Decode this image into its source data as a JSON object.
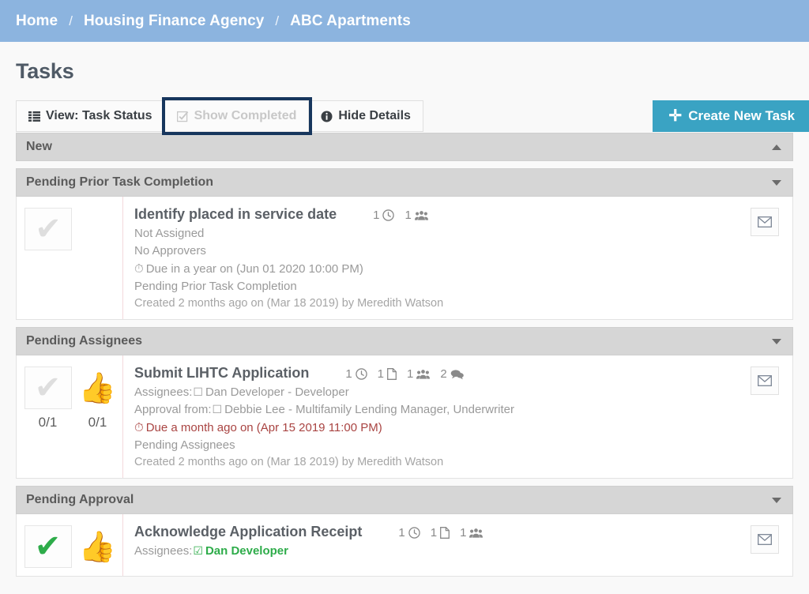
{
  "breadcrumb": {
    "separator": "/",
    "items": [
      {
        "label": "Home"
      },
      {
        "label": "Housing Finance Agency"
      },
      {
        "label": "ABC Apartments"
      }
    ]
  },
  "page": {
    "title": "Tasks"
  },
  "toolbar": {
    "view_label": "View: Task Status",
    "view_icon": "list-icon",
    "show_completed_label": "Show Completed",
    "show_completed_icon": "checkbox-checked-icon",
    "show_completed_disabled": true,
    "show_completed_focused": true,
    "hide_details_label": "Hide Details",
    "hide_details_icon": "info-icon",
    "create_label": "Create New Task",
    "create_icon": "plus-icon",
    "create_color": "#3aa3c3",
    "focus_ring_color": "#17365d"
  },
  "colors": {
    "breadcrumb_bg": "#8cb4df",
    "page_bg": "#f9f9f9",
    "section_bg": "#d6d6d6",
    "overdue": "#a94442",
    "complete_green": "#2eac4a",
    "card_divider": "#f3d8dc"
  },
  "sections": [
    {
      "title": "New",
      "caret": "caret-up-icon",
      "expanded": true,
      "tasks": []
    },
    {
      "title": "Pending Prior Task Completion",
      "caret": "caret-down-icon",
      "expanded": true,
      "tasks": [
        {
          "name": "Identify placed in service date",
          "complete_count": "",
          "approve_count": "",
          "has_approve_button": false,
          "checkmark_state": "pending",
          "badges": [
            {
              "count": "1",
              "icon": "clock-icon"
            },
            {
              "count": "1",
              "icon": "users-icon"
            }
          ],
          "assignees_line": "Not Assigned",
          "approvers_line": "No Approvers",
          "due_line": "Due in a year on (Jun 01 2020 10:00 PM)",
          "due_overdue": false,
          "status_line": "Pending Prior Task Completion",
          "created_line": "Created 2 months ago on (Mar 18 2019) by Meredith Watson",
          "mail_icon": "envelope-icon"
        }
      ]
    },
    {
      "title": "Pending Assignees",
      "caret": "caret-down-icon",
      "expanded": true,
      "tasks": [
        {
          "name": "Submit LIHTC Application",
          "complete_count": "0/1",
          "approve_count": "0/1",
          "has_approve_button": true,
          "checkmark_state": "pending",
          "badges": [
            {
              "count": "1",
              "icon": "clock-icon"
            },
            {
              "count": "1",
              "icon": "file-icon"
            },
            {
              "count": "1",
              "icon": "users-icon"
            },
            {
              "count": "2",
              "icon": "comments-icon"
            }
          ],
          "assignees_label": "Assignees:",
          "assignees_checkbox": "checkbox-empty-icon",
          "assignees_value": "Dan Developer - Developer",
          "approvers_label": "Approval from:",
          "approvers_checkbox": "checkbox-empty-icon",
          "approvers_value": "Debbie Lee - Multifamily Lending Manager, Underwriter",
          "due_line": "Due a month ago on (Apr 15 2019 11:00 PM)",
          "due_overdue": true,
          "status_line": "Pending Assignees",
          "created_line": "Created 2 months ago on (Mar 18 2019) by Meredith Watson",
          "mail_icon": "envelope-icon"
        }
      ]
    },
    {
      "title": "Pending Approval",
      "caret": "caret-down-icon",
      "expanded": true,
      "tasks": [
        {
          "name": "Acknowledge Application Receipt",
          "complete_count": "",
          "approve_count": "",
          "has_approve_button": true,
          "checkmark_state": "done",
          "badges": [
            {
              "count": "1",
              "icon": "clock-icon"
            },
            {
              "count": "1",
              "icon": "file-icon"
            },
            {
              "count": "1",
              "icon": "users-icon"
            }
          ],
          "assignees_label": "Assignees:",
          "assignees_checkbox": "checkbox-checked-icon",
          "assignees_value": "Dan Developer",
          "assignees_complete": true,
          "mail_icon": "envelope-icon"
        }
      ]
    }
  ]
}
